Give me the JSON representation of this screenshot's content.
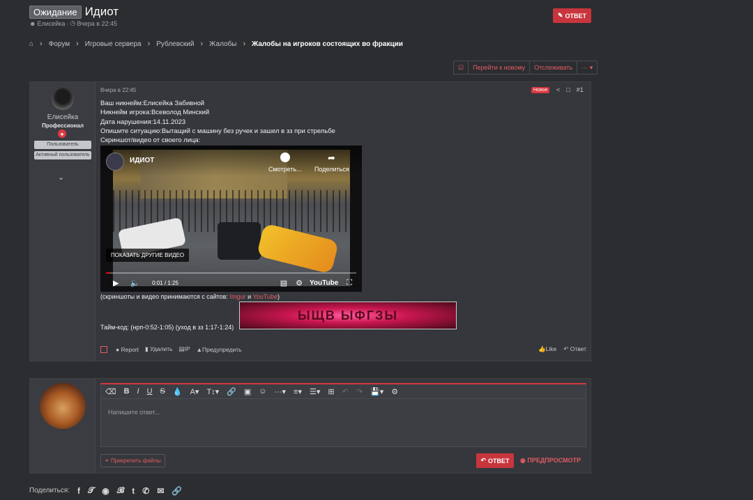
{
  "thread": {
    "prefix": "Ожидание",
    "title": "Идиот",
    "author": "Елисейка",
    "date": "Вчера в 22:45",
    "reply_label": "ОТВЕТ"
  },
  "breadcrumbs": [
    "Форум",
    "Игровые сервера",
    "Рублевский",
    "Жалобы",
    "Жалобы на игроков состоящих во фракции"
  ],
  "toolbar": {
    "goto_new": "Перейти к новому",
    "watch": "Отслеживать",
    "more": "···"
  },
  "post": {
    "user": {
      "name": "Елисейка",
      "title": "Профессионал",
      "badges": [
        "Пользователь",
        "Активный пользователь"
      ]
    },
    "date": "Вчера в 22:45",
    "new_label": "Новое",
    "number": "#1",
    "lines": [
      "Ваш никнейм:Елисейка Забивной",
      "Никнейм игрока:Всеволод Минский",
      "Дата нарушения:14.11.2023",
      "Опишите ситуацию:Вытащий с машину без ручек и зашел в зз при стрельбе",
      "Скриншот/видео от своего лица:"
    ],
    "video": {
      "title": "ИДИОТ",
      "watch_later": "Смотреть...",
      "share": "Поделиться",
      "more_videos": "ПОКАЗАТЬ ДРУГИЕ ВИДЕО",
      "time": "0:01 / 1:25",
      "progress": 0.013,
      "brand": "YouTube"
    },
    "sites_prefix": "(скриншоты и видео принимаются с сайтов: ",
    "site1": "Imgur",
    "sites_and": " и ",
    "site2": "YouTube",
    "sites_suffix": ")",
    "timecode": "Тайм-код: (нрп-0:52-1:05) (уход в зз 1:17-1:24)",
    "image_text": "ЫЩВ ЫФГЗЫ",
    "actions": {
      "report": "Report",
      "delete": "Удалить",
      "ip": "IP",
      "warn": "Предупредить",
      "like": "Like",
      "reply": "Ответ"
    }
  },
  "reply_box": {
    "placeholder": "Напишите ответ...",
    "attach": "Прикрепить файлы",
    "reply": "ОТВЕТ",
    "preview": "ПРЕДПРОСМОТР"
  },
  "share": {
    "label": "Поделиться:",
    "icons": [
      "f",
      "t",
      "r",
      "p",
      "t",
      "w",
      "m",
      "l"
    ]
  }
}
